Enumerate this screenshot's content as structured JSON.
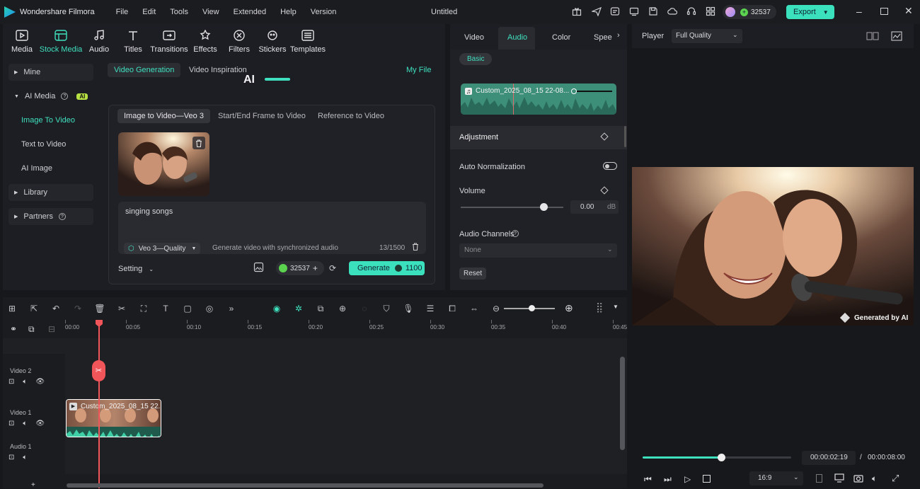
{
  "titlebar": {
    "app": "Wondershare Filmora",
    "menus": [
      "File",
      "Edit",
      "Tools",
      "View",
      "Extended",
      "Help",
      "Version"
    ],
    "doc_title": "Untitled",
    "credits": "32537",
    "export": "Export"
  },
  "toolbar_tabs": [
    {
      "label": "Media",
      "icon": "media-icon"
    },
    {
      "label": "Stock Media",
      "icon": "stock-media-icon"
    },
    {
      "label": "Audio",
      "icon": "audio-icon"
    },
    {
      "label": "Titles",
      "icon": "titles-icon"
    },
    {
      "label": "Transitions",
      "icon": "transitions-icon"
    },
    {
      "label": "Effects",
      "icon": "effects-icon"
    },
    {
      "label": "Filters",
      "icon": "filters-icon"
    },
    {
      "label": "Stickers",
      "icon": "stickers-icon"
    },
    {
      "label": "Templates",
      "icon": "templates-icon"
    }
  ],
  "sidebar": {
    "mine": "Mine",
    "ai_media": "AI Media",
    "ai_badge": "AI",
    "image_to_video": "Image To Video",
    "text_to_video": "Text to Video",
    "ai_image": "AI Image",
    "library": "Library",
    "partners": "Partners"
  },
  "content": {
    "tab_gen": "Video Generation",
    "tab_insp": "Video Inspiration",
    "my_file": "My File",
    "banner_text": "AI",
    "subtabs": [
      "Image to Video—Veo 3",
      "Start/End Frame to Video",
      "Reference to Video"
    ],
    "prompt": "singing songs",
    "model": "Veo 3—Quality",
    "hint": "Generate video with synchronized audio",
    "count": "13/1500",
    "setting": "Setting",
    "credits": "32537",
    "generate": "Generate",
    "cost": "1100"
  },
  "props": {
    "tabs": [
      "Video",
      "Audio",
      "Color",
      "Speed"
    ],
    "basic": "Basic",
    "clip_name": "Custom_2025_08_15 22-08...",
    "adjustment": "Adjustment",
    "auto_norm": "Auto Normalization",
    "volume": "Volume",
    "vol_value": "0.00",
    "vol_unit": "dB",
    "channels": "Audio Channels",
    "channel_value": "None",
    "reset": "Reset"
  },
  "player": {
    "label": "Player",
    "quality": "Full Quality",
    "watermark": "Generated by AI",
    "current": "00:00:02:19",
    "sep": "/",
    "total": "00:00:08:00",
    "ratio": "16:9",
    "progress": 0.53
  },
  "timeline": {
    "ticks": [
      "00:00",
      "00:05",
      "00:10",
      "00:15",
      "00:20",
      "00:25",
      "00:30",
      "00:35",
      "00:40",
      "00:45"
    ],
    "tracks": {
      "video2": "Video 2",
      "video1": "Video 1",
      "audio1": "Audio 1"
    },
    "clip": "Custom_2025_08_15 22..."
  },
  "colors": {
    "accent": "#2fd5b2",
    "playhead": "#f0555a"
  }
}
